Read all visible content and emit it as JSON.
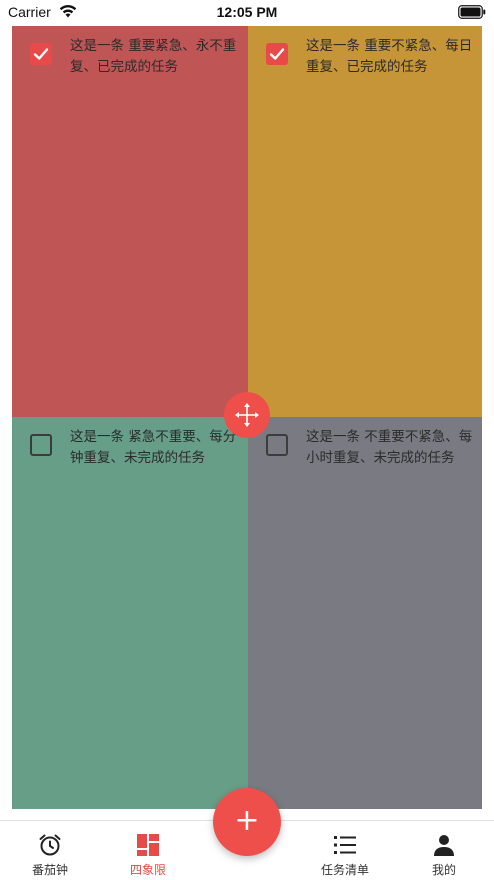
{
  "status_bar": {
    "carrier": "Carrier",
    "time": "12:05 PM"
  },
  "quadrants": [
    {
      "color": "#c05555",
      "task": {
        "text": "这是一条  重要紧急、永不重复、已完成的任务",
        "checked": true
      }
    },
    {
      "color": "#c59537",
      "task": {
        "text": "这是一条  重要不紧急、每日重复、已完成的任务",
        "checked": true
      }
    },
    {
      "color": "#679e87",
      "task": {
        "text": "这是一条  紧急不重要、每分钟重复、未完成的任务",
        "checked": false
      }
    },
    {
      "color": "#7a7a82",
      "task": {
        "text": "这是一条  不重要不紧急、每小时重复、未完成的任务",
        "checked": false
      }
    }
  ],
  "center_handle": {
    "icon": "move-arrows-icon"
  },
  "fab": {
    "label": "+",
    "icon": "plus-icon"
  },
  "tabs": [
    {
      "label": "番茄钟",
      "icon": "alarm-clock-icon",
      "active": false
    },
    {
      "label": "四象限",
      "icon": "quadrant-grid-icon",
      "active": true
    },
    {
      "label": "任务清单",
      "icon": "list-icon",
      "active": false
    },
    {
      "label": "我的",
      "icon": "person-icon",
      "active": false
    }
  ],
  "colors": {
    "accent": "#e84a4a",
    "tab_inactive": "#333333"
  }
}
